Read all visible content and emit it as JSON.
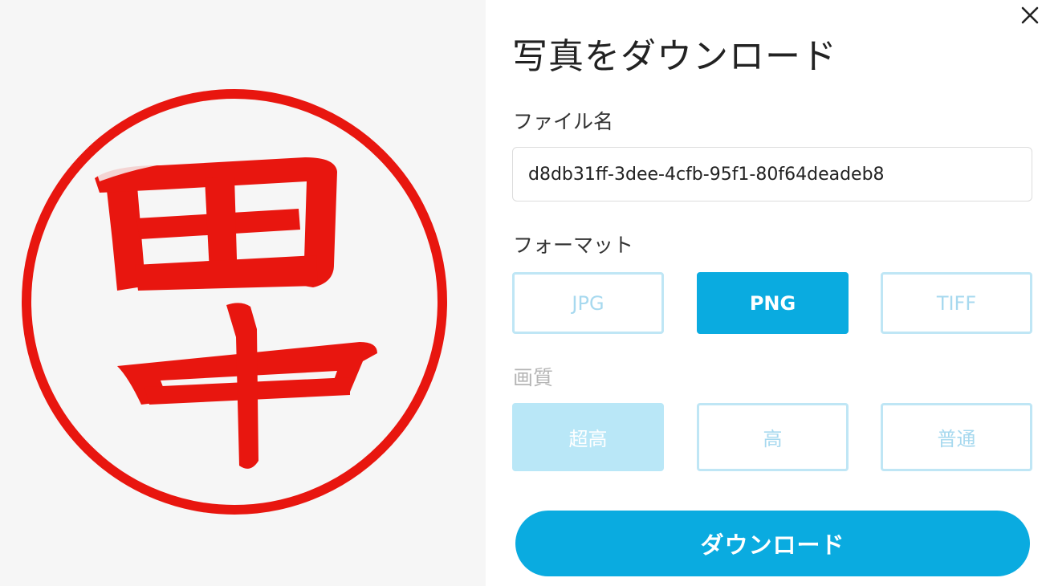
{
  "dialog": {
    "title": "写真をダウンロード",
    "close_icon": "close-icon"
  },
  "preview": {
    "stamp_text": "田中",
    "stamp_color": "#e8160f"
  },
  "filename": {
    "label": "ファイル名",
    "value": "d8db31ff-3dee-4cfb-95f1-80f64deadeb8"
  },
  "format": {
    "label": "フォーマット",
    "options": [
      "JPG",
      "PNG",
      "TIFF"
    ],
    "selected": "PNG"
  },
  "quality": {
    "label": "画質",
    "options": [
      "超高",
      "高",
      "普通"
    ],
    "selected": "超高"
  },
  "download_button": {
    "label": "ダウンロード"
  },
  "colors": {
    "accent": "#0aabe0",
    "accent_soft": "#b9e7f7",
    "border_soft": "#bfe6f5",
    "preview_bg": "#f6f6f6"
  }
}
